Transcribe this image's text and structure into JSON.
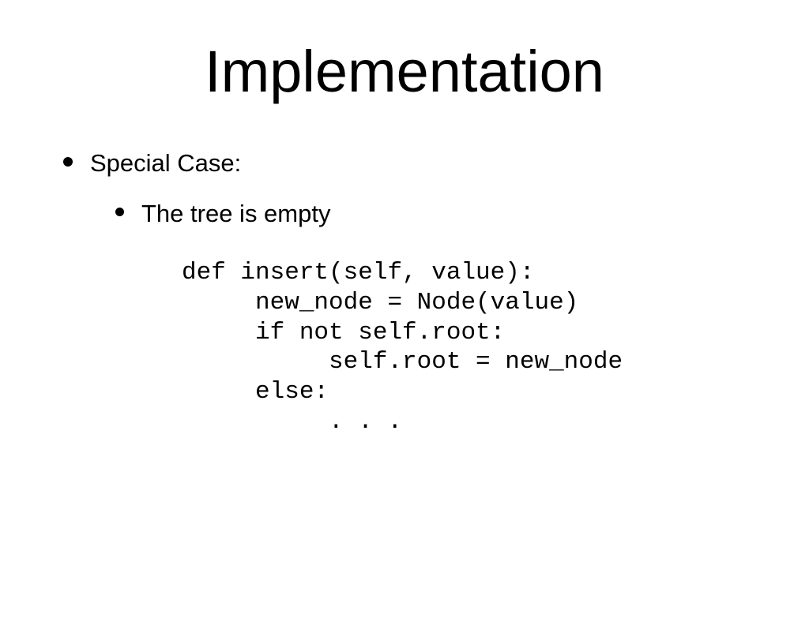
{
  "title": "Implementation",
  "bullets": {
    "level1": "Special Case:",
    "level2": "The tree is empty"
  },
  "code": "def insert(self, value):\n     new_node = Node(value)\n     if not self.root:\n          self.root = new_node\n     else:\n          . . ."
}
